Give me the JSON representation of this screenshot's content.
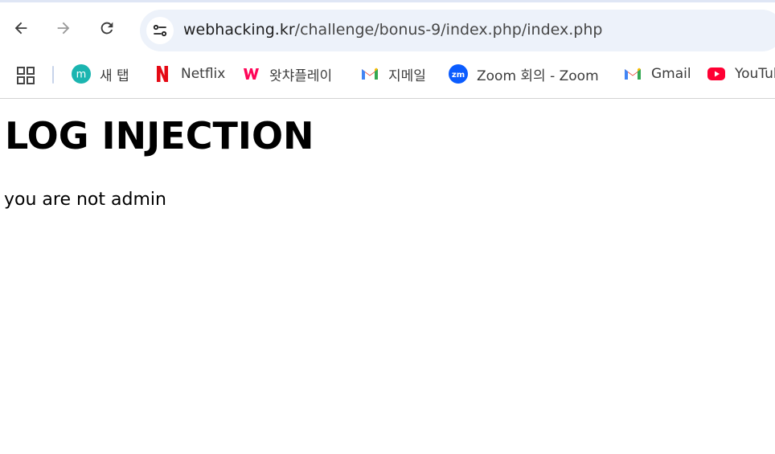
{
  "browser": {
    "url_host": "webhacking.kr",
    "url_path": "/challenge/bonus-9/index.php/index.php"
  },
  "bookmarks": [
    {
      "label": "새 탭",
      "icon": "new-tab-m-icon"
    },
    {
      "label": "Netflix",
      "icon": "netflix-icon"
    },
    {
      "label": "왓챠플레이",
      "icon": "watcha-icon"
    },
    {
      "label": "지메일",
      "icon": "gmail-icon"
    },
    {
      "label": "Zoom 회의 - Zoom",
      "icon": "zoom-icon"
    },
    {
      "label": "Gmail",
      "icon": "gmail-icon"
    },
    {
      "label": "YouTube",
      "icon": "youtube-icon"
    }
  ],
  "page": {
    "title": "LOG INJECTION",
    "message": "you are not admin"
  },
  "colors": {
    "accent_bar": "#dfe6f5",
    "omnibox_bg": "#edf2fa",
    "netflix_red": "#e50914",
    "watcha_pink": "#ff0558",
    "zoom_blue": "#0b5cff",
    "youtube_red": "#ff0033"
  }
}
